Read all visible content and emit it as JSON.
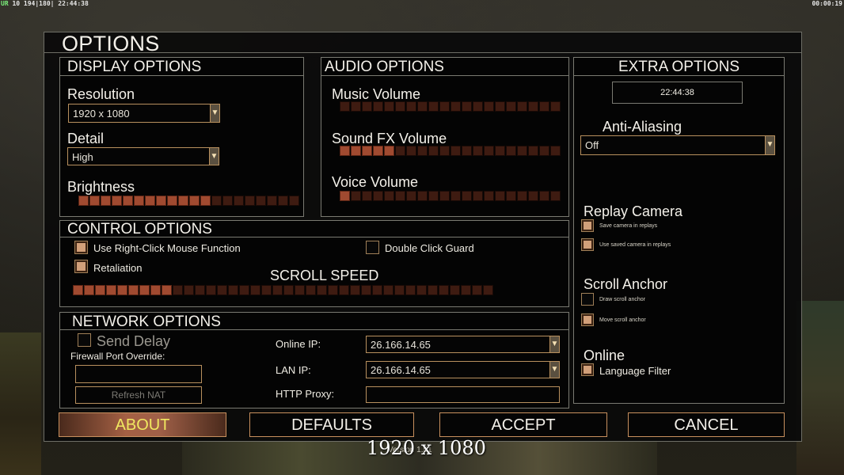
{
  "hud": {
    "left_prefix": "UR",
    "left_values": "10 194|180|",
    "left_time": "22:44:38",
    "right_time": "00:00:19"
  },
  "window": {
    "title": "OPTIONS"
  },
  "display": {
    "header": "DISPLAY OPTIONS",
    "resolution_label": "Resolution",
    "resolution_value": "1920 x 1080",
    "detail_label": "Detail",
    "detail_value": "High",
    "brightness_label": "Brightness",
    "brightness_level": 12,
    "brightness_segments": 20
  },
  "audio": {
    "header": "AUDIO OPTIONS",
    "music_label": "Music Volume",
    "music_level": 0,
    "sfx_label": "Sound FX Volume",
    "sfx_level": 5,
    "voice_label": "Voice Volume",
    "voice_level": 1,
    "segments": 20
  },
  "extra": {
    "header": "EXTRA OPTIONS",
    "clock": "22:44:38",
    "aa_label": "Anti-Aliasing",
    "aa_value": "Off",
    "replay_label": "Replay Camera",
    "replay_save": "Save camera in replays",
    "replay_use": "Use saved camera in replays",
    "anchor_label": "Scroll Anchor",
    "anchor_draw": "Draw scroll anchor",
    "anchor_move": "Move scroll anchor",
    "online_label": "Online",
    "language_filter": "Language Filter"
  },
  "control": {
    "header": "CONTROL OPTIONS",
    "right_click": "Use Right-Click Mouse Function",
    "retaliation": "Retaliation",
    "double_click": "Double Click Guard",
    "scroll_speed_label": "SCROLL SPEED",
    "scroll_level": 9,
    "scroll_segments": 38
  },
  "network": {
    "header": "NETWORK OPTIONS",
    "send_delay": "Send Delay",
    "firewall_label": "Firewall Port Override:",
    "firewall_value": "",
    "refresh_nat": "Refresh NAT",
    "online_ip_label": "Online IP:",
    "online_ip_value": "26.166.14.65",
    "lan_ip_label": "LAN IP:",
    "lan_ip_value": "26.166.14.65",
    "http_proxy_label": "HTTP Proxy:",
    "http_proxy_value": ""
  },
  "buttons": {
    "about": "ABOUT",
    "defaults": "DEFAULTS",
    "accept": "ACCEPT",
    "cancel": "CANCEL"
  },
  "footer": {
    "resolution": "1920 x 1080",
    "version": "Version 1.51"
  },
  "colors": {
    "accent": "#c8905e",
    "slider_on": "#a04a30",
    "slider_off": "#3e1b11",
    "highlight_text": "#f0e860"
  }
}
